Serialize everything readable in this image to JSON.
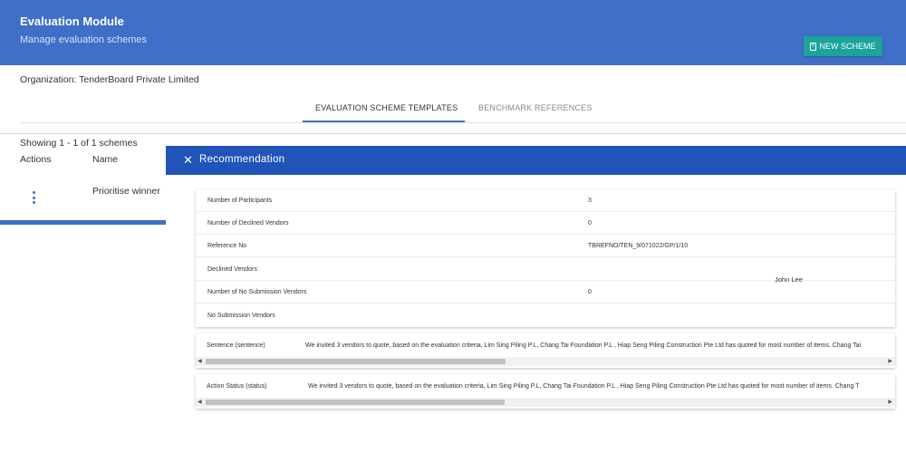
{
  "header": {
    "title": "Evaluation Module",
    "subtitle": "Manage evaluation schemes",
    "new_button": "NEW SCHEME"
  },
  "organization": "Organization: TenderBoard Private Limited",
  "tabs": [
    {
      "label": "EVALUATION SCHEME TEMPLATES",
      "active": true
    },
    {
      "label": "BENCHMARK REFERENCES",
      "active": false
    }
  ],
  "list": {
    "showing": "Showing 1 - 1 of 1 schemes",
    "columns": {
      "actions": "Actions",
      "name": "Name"
    },
    "rows": [
      {
        "name": "Prioritise winner"
      }
    ]
  },
  "panel": {
    "title": "Recommendation",
    "details": [
      {
        "label": "Number of Participants",
        "value": "3"
      },
      {
        "label": "Number of Declined Vendors",
        "value": "0"
      },
      {
        "label": "Reference No",
        "value": "TBREFNO/TEN_9/071022/GP/1/10"
      },
      {
        "label": "Declined Vendors",
        "value": ""
      },
      {
        "label": "Number of No Submission Vendors",
        "value": "0"
      },
      {
        "label": "No Submission Vendors",
        "value": ""
      }
    ],
    "assignee": "John Lee",
    "sentence": {
      "label": "Sentence (sentence)",
      "text": "We invited 3 vendors to quote, based on the evaluation criteria, Lim Sing Piling P.L, Chang Tai Foundation P.L , Hiap Seng Piling Construction Pte Ltd has quoted for most number of items. Chang Tai"
    },
    "action_status": {
      "label": "Action Status (status)",
      "text": "We invited 3 vendors to quote, based on the evaluation criteria, Lim Sing Piling P.L, Chang Tai Foundation P.L , Hiap Seng Piling Construction Pte Ltd has quoted for most number of items. Chang T"
    }
  },
  "colors": {
    "header_bg": "#3f6fc8",
    "panel_header_bg": "#2154b8",
    "button_bg": "#1aa49a"
  }
}
